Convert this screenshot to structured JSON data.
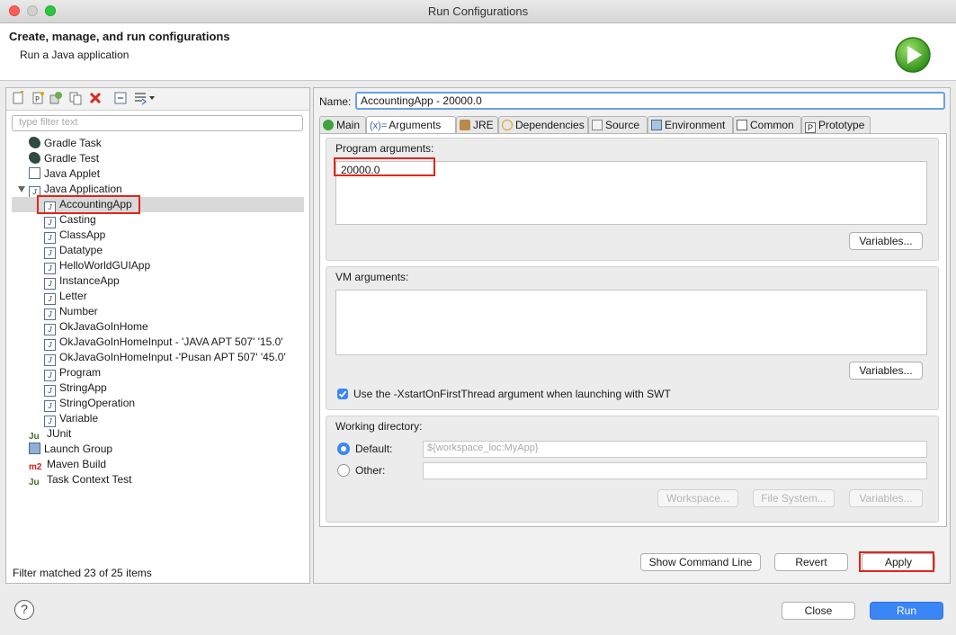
{
  "window": {
    "title": "Run Configurations",
    "traffic_lights": {
      "close": "#fd5f57",
      "minimize": "#cfcfcf",
      "zoom": "#2dc840"
    }
  },
  "header": {
    "title": "Create, manage, and run configurations",
    "subtitle": "Run a Java application",
    "logo_icon": "run-play-icon"
  },
  "sidebar": {
    "toolbar_icons": [
      "new-configuration-icon",
      "new-prototype-icon",
      "export-icon",
      "duplicate-icon",
      "delete-icon",
      "collapse-all-icon",
      "filter-icon",
      "menu-chevron-down-icon"
    ],
    "filter_placeholder": "type filter text",
    "tree": [
      {
        "label": "Gradle Task",
        "icon": "gradle-icon"
      },
      {
        "label": "Gradle Test",
        "icon": "gradle-icon"
      },
      {
        "label": "Java Applet",
        "icon": "java-applet-icon"
      },
      {
        "label": "Java Application",
        "icon": "java-app-icon",
        "expanded": true
      },
      {
        "label": "AccountingApp",
        "icon": "java-app-icon",
        "selected": true
      },
      {
        "label": "Casting",
        "icon": "java-app-icon"
      },
      {
        "label": "ClassApp",
        "icon": "java-app-icon"
      },
      {
        "label": "Datatype",
        "icon": "java-app-icon"
      },
      {
        "label": "HelloWorldGUIApp",
        "icon": "java-app-icon"
      },
      {
        "label": "InstanceApp",
        "icon": "java-app-icon"
      },
      {
        "label": "Letter",
        "icon": "java-app-icon"
      },
      {
        "label": "Number",
        "icon": "java-app-icon"
      },
      {
        "label": "OkJavaGoInHome",
        "icon": "java-app-icon"
      },
      {
        "label": "OkJavaGoInHomeInput - 'JAVA APT 507' '15.0'",
        "icon": "java-app-icon"
      },
      {
        "label": "OkJavaGoInHomeInput -'Pusan APT 507' '45.0'",
        "icon": "java-app-icon"
      },
      {
        "label": "Program",
        "icon": "java-app-icon"
      },
      {
        "label": "StringApp",
        "icon": "java-app-icon"
      },
      {
        "label": "StringOperation",
        "icon": "java-app-icon"
      },
      {
        "label": "Variable",
        "icon": "java-app-icon"
      },
      {
        "label": "JUnit",
        "icon": "junit-icon"
      },
      {
        "label": "Launch Group",
        "icon": "launch-group-icon"
      },
      {
        "label": "Maven Build",
        "icon": "maven-icon"
      },
      {
        "label": "Task Context Test",
        "icon": "junit-icon"
      }
    ],
    "filter_status": "Filter matched 23 of 25 items"
  },
  "config": {
    "name_label": "Name:",
    "name_value": "AccountingApp - 20000.0",
    "tabs": [
      {
        "label": "Main",
        "icon": "main-tab-icon"
      },
      {
        "label": "Arguments",
        "icon": "arguments-icon",
        "prefix": "(x)=",
        "active": true
      },
      {
        "label": "JRE",
        "icon": "jre-icon"
      },
      {
        "label": "Dependencies",
        "icon": "dependencies-icon"
      },
      {
        "label": "Source",
        "icon": "source-icon"
      },
      {
        "label": "Environment",
        "icon": "environment-icon"
      },
      {
        "label": "Common",
        "icon": "common-icon"
      },
      {
        "label": "Prototype",
        "icon": "prototype-icon",
        "prefix": "P"
      }
    ],
    "program_args": {
      "label": "Program arguments:",
      "value": "20000.0",
      "variables_button": "Variables..."
    },
    "vm_args": {
      "label": "VM arguments:",
      "value": "",
      "variables_button": "Variables...",
      "swt_checkbox_label": "Use the -XstartOnFirstThread argument when launching with SWT",
      "swt_checked": true
    },
    "working_dir": {
      "label": "Working directory:",
      "default_label": "Default:",
      "default_value": "${workspace_loc:MyApp}",
      "other_label": "Other:",
      "other_value": "",
      "selected": "default",
      "workspace_button": "Workspace...",
      "filesystem_button": "File System...",
      "variables_button": "Variables..."
    },
    "buttons": {
      "show_command_line": "Show Command Line",
      "revert": "Revert",
      "apply": "Apply"
    }
  },
  "footer": {
    "help_icon": "help-icon",
    "close": "Close",
    "run": "Run"
  },
  "colors": {
    "accent": "#3b86f5",
    "highlight": "#e0261b",
    "selection": "#d9d9d9"
  }
}
